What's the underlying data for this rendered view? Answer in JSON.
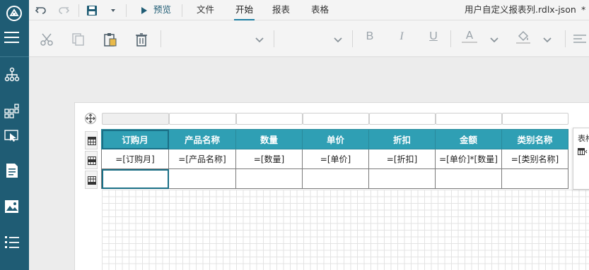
{
  "toolbar": {
    "preview_label": "预览",
    "tabs": [
      "文件",
      "开始",
      "报表",
      "表格"
    ],
    "active_tab": "开始",
    "filename": "用户自定义报表列.rdlx-json",
    "modified_marker": "*"
  },
  "ribbon": {
    "bold_label": "B",
    "italic_label": "I",
    "underline_label": "U",
    "font_color_label": "A"
  },
  "table": {
    "headers": [
      "订购月",
      "产品名称",
      "数量",
      "单价",
      "折扣",
      "金额",
      "类别名称"
    ],
    "details": [
      "=[订购月]",
      "=[产品名称]",
      "=[数量]",
      "=[单价]",
      "=[折扣]",
      "=[单价]*[数量]",
      "=[类别名称]"
    ]
  },
  "side_panel": {
    "label": "表格"
  },
  "colors": {
    "rail": "#1f5c74",
    "header_fill": "#2f9fb4",
    "accent": "#1f7fa3"
  }
}
